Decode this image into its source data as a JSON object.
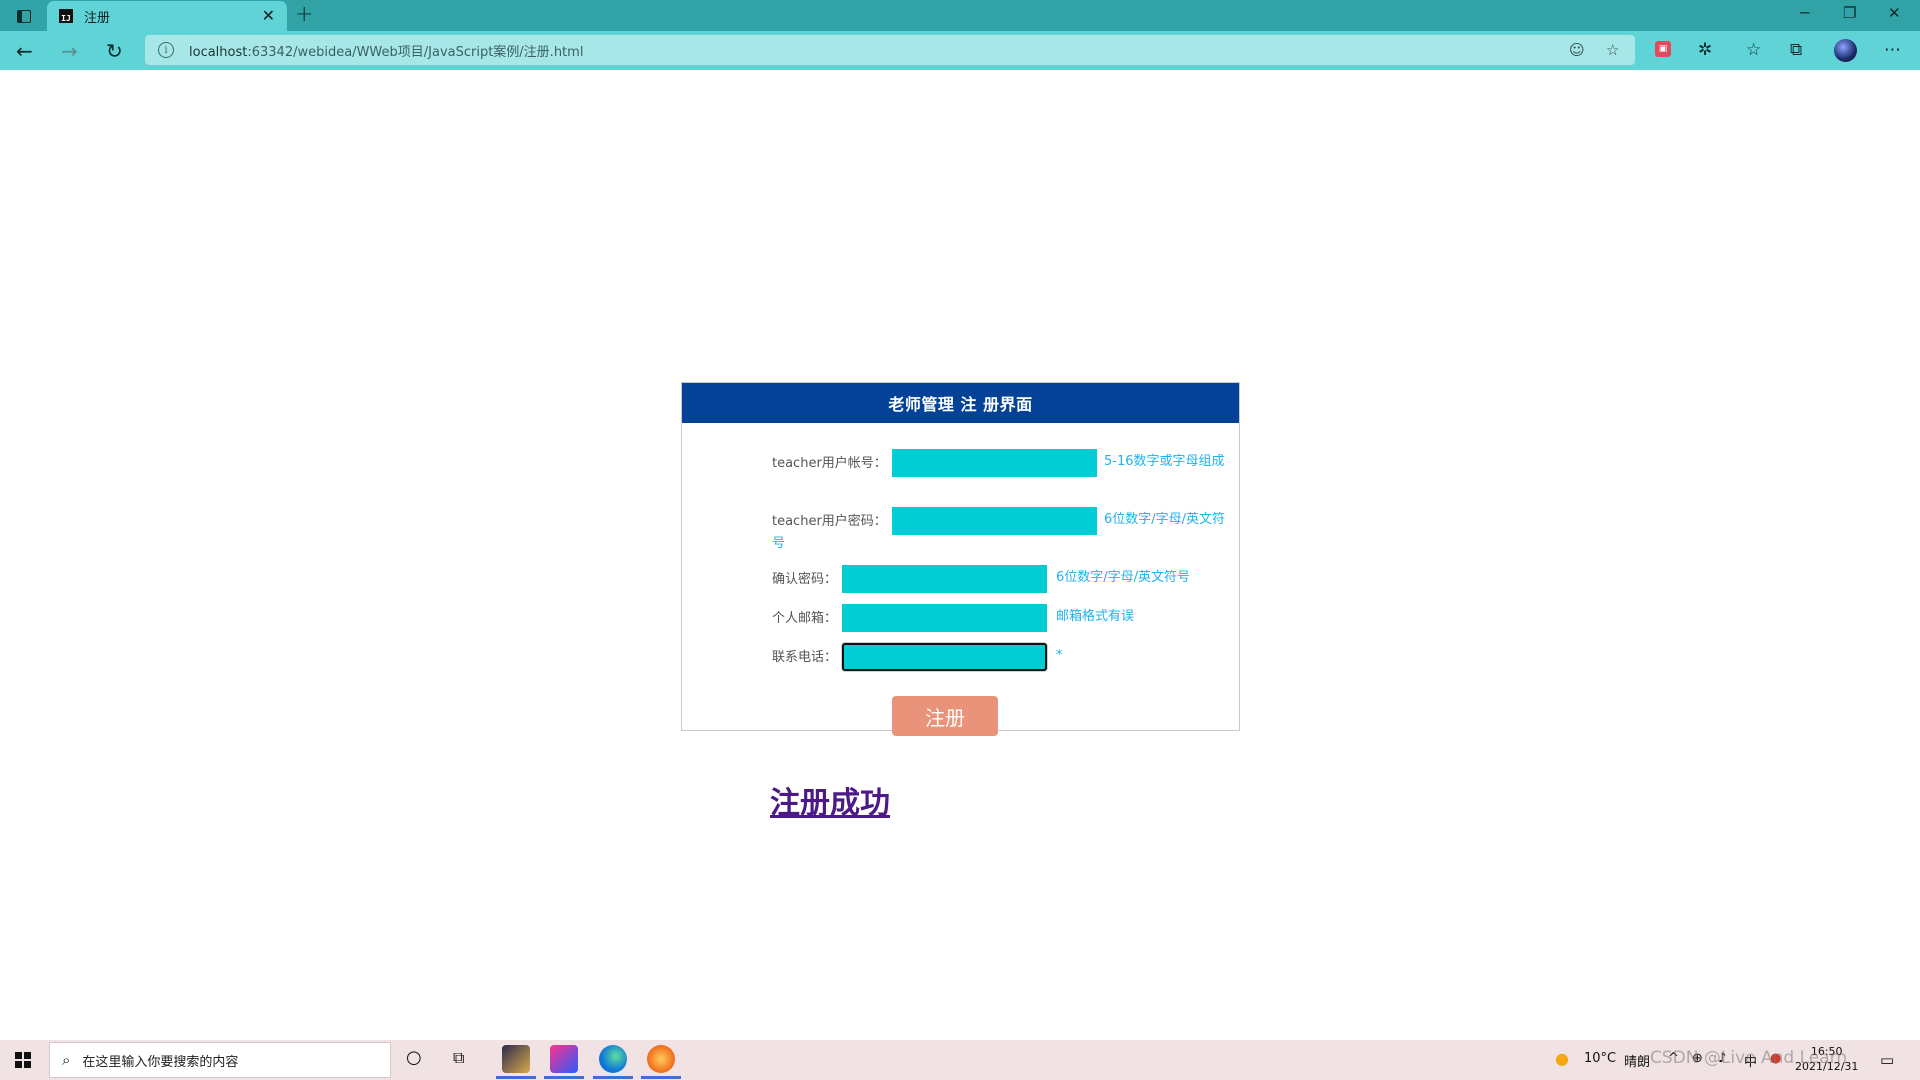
{
  "browser": {
    "tab_title": "注册",
    "tab_favicon_text": "IJ",
    "url_host": "localhost",
    "url_rest": ":63342/webidea/WWeb项目/JavaScript案例/注册.html"
  },
  "form": {
    "title": "老师管理 注 册界面",
    "fields": [
      {
        "label": "teacher用户帐号：",
        "hint": "5-16数字或字母组成"
      },
      {
        "label": "teacher用户密码：",
        "hint": "6位数字/字母/英文符号"
      },
      {
        "label": "确认密码：",
        "hint": "6位数字/字母/英文符号"
      },
      {
        "label": "个人邮箱：",
        "hint": "邮箱格式有误"
      },
      {
        "label": "联系电话：",
        "hint": "*"
      }
    ],
    "submit_label": "注册"
  },
  "success_link": "注册成功",
  "taskbar": {
    "search_placeholder": "在这里输入你要搜索的内容",
    "weather_temp": "10°C",
    "weather_desc": "晴朗",
    "time": "16:50",
    "date": "2021/12/31",
    "watermark": "CSDN @Live And Learn"
  },
  "colors": {
    "header_blue": "#044298",
    "field_cyan": "#00cdd4",
    "hint_blue": "#1fb1ee",
    "submit_salmon": "#e8937a",
    "link_purple": "#4b1a86"
  }
}
